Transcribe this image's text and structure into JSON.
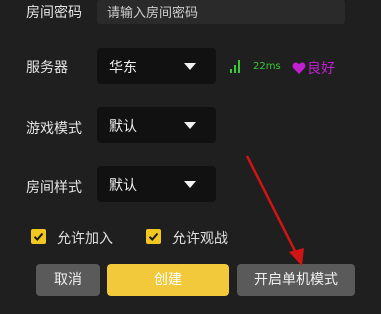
{
  "room_password": {
    "label": "房间密码",
    "placeholder": "请输入房间密码"
  },
  "server": {
    "label": "服务器",
    "value": "华东",
    "ping": "22ms",
    "signal_color": "#33cc33",
    "quality_text": "良好",
    "quality_color": "#c020d0"
  },
  "game_mode": {
    "label": "游戏模式",
    "value": "默认"
  },
  "room_style": {
    "label": "房间样式",
    "value": "默认"
  },
  "options": {
    "allow_join": "允许加入",
    "allow_spectate": "允许观战"
  },
  "buttons": {
    "cancel": "取消",
    "create": "创建",
    "single_player": "开启单机模式"
  }
}
